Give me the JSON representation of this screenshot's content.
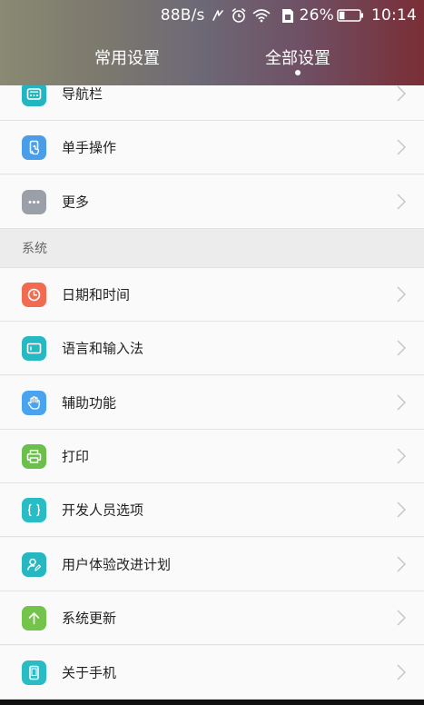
{
  "status_bar": {
    "net_speed": "88B/s",
    "battery_level": "26%",
    "time": "10:14",
    "icons": [
      "nfc-icon",
      "alarm-icon",
      "wifi-icon",
      "sim-icon",
      "battery-icon"
    ]
  },
  "tabs": [
    {
      "label": "常用设置",
      "selected": false
    },
    {
      "label": "全部设置",
      "selected": true
    }
  ],
  "items": [
    {
      "label": "导航栏",
      "icon": "navbar-icon",
      "color": "#23b5c0"
    },
    {
      "label": "单手操作",
      "icon": "one-hand-icon",
      "color": "#4a9de8"
    },
    {
      "label": "更多",
      "icon": "more-icon",
      "color": "#9a9fa8"
    },
    {
      "label": "日期和时间",
      "icon": "clock-icon",
      "color": "#f26a50"
    },
    {
      "label": "语言和输入法",
      "icon": "keyboard-icon",
      "color": "#27b9c3"
    },
    {
      "label": "辅助功能",
      "icon": "hand-icon",
      "color": "#4aa3ef"
    },
    {
      "label": "打印",
      "icon": "printer-icon",
      "color": "#6ac04b"
    },
    {
      "label": "开发人员选项",
      "icon": "braces-icon",
      "color": "#28bcc5"
    },
    {
      "label": "用户体验改进计划",
      "icon": "user-edit-icon",
      "color": "#27b7c1"
    },
    {
      "label": "系统更新",
      "icon": "arrow-up-icon",
      "color": "#74c34a"
    },
    {
      "label": "关于手机",
      "icon": "phone-icon",
      "color": "#28bcc5"
    }
  ],
  "section": {
    "label": "系统"
  }
}
